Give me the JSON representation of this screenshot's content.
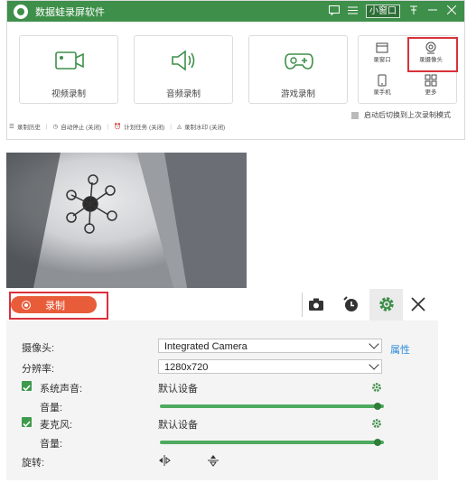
{
  "app": {
    "title": "数据蛙录屏软件",
    "mini_window_label": "小窗口"
  },
  "modes": [
    {
      "label": "视频录制",
      "icon": "video-camera-icon"
    },
    {
      "label": "音频录制",
      "icon": "speaker-icon"
    },
    {
      "label": "游戏录制",
      "icon": "gamepad-icon"
    }
  ],
  "quick_tools": [
    {
      "label": "录窗口",
      "icon": "window-icon"
    },
    {
      "label": "录摄像头",
      "icon": "webcam-icon"
    },
    {
      "label": "录手机",
      "icon": "phone-icon"
    },
    {
      "label": "更多",
      "icon": "more-grid-icon"
    }
  ],
  "auto_switch_label": "启动后切换到上次录制模式",
  "status_bar": {
    "history": "录制历史",
    "auto_stop": "自动停止 (关闭)",
    "schedule": "计划任务 (关闭)",
    "watermark": "录制水印 (关闭)"
  },
  "recorder": {
    "record_label": "录制",
    "camera_label": "摄像头:",
    "camera_value": "Integrated Camera",
    "properties_link": "属性",
    "resolution_label": "分辨率:",
    "resolution_value": "1280x720",
    "system_audio_label": "系统声音:",
    "system_audio_value": "默认设备",
    "system_volume_label": "音量:",
    "system_volume_level": 0.97,
    "mic_label": "麦克风:",
    "mic_value": "默认设备",
    "mic_volume_label": "音量:",
    "mic_volume_level": 0.97,
    "rotate_label": "旋转:"
  },
  "colors": {
    "brand_green": "#3e8f4a",
    "record_orange": "#e85c3a",
    "highlight_red": "#d9323b",
    "link_blue": "#2e8bd8"
  }
}
